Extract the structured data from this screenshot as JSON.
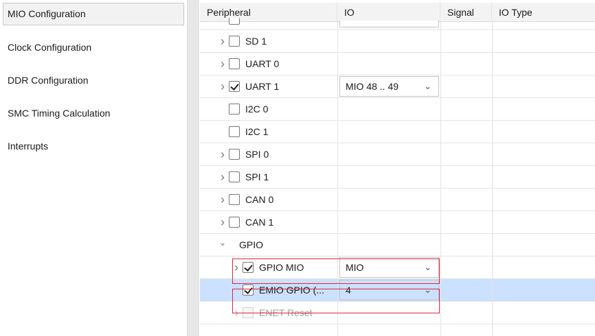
{
  "nav": {
    "items": [
      {
        "label": "MIO Configuration",
        "selected": true
      },
      {
        "label": "Clock Configuration",
        "selected": false
      },
      {
        "label": "DDR Configuration",
        "selected": false
      },
      {
        "label": "SMC Timing Calculation",
        "selected": false
      },
      {
        "label": "Interrupts",
        "selected": false
      }
    ]
  },
  "table": {
    "headers": {
      "peripheral": "Peripheral",
      "io": "IO",
      "signal": "Signal",
      "io_type": "IO Type"
    },
    "rows": [
      {
        "label": "SD 1",
        "expandable": true,
        "checked": false,
        "io": ""
      },
      {
        "label": "UART 0",
        "expandable": true,
        "checked": false,
        "io": ""
      },
      {
        "label": "UART 1",
        "expandable": true,
        "checked": true,
        "io": "MIO 48 .. 49"
      },
      {
        "label": "I2C 0",
        "expandable": false,
        "checked": false,
        "io": ""
      },
      {
        "label": "I2C 1",
        "expandable": false,
        "checked": false,
        "io": ""
      },
      {
        "label": "SPI 0",
        "expandable": true,
        "checked": false,
        "io": ""
      },
      {
        "label": "SPI 1",
        "expandable": true,
        "checked": false,
        "io": ""
      },
      {
        "label": "CAN 0",
        "expandable": true,
        "checked": false,
        "io": ""
      },
      {
        "label": "CAN 1",
        "expandable": true,
        "checked": false,
        "io": ""
      },
      {
        "label": "GPIO",
        "group": true,
        "expanded": true
      },
      {
        "label": "GPIO MIO",
        "expandable": true,
        "checked": true,
        "io": "MIO",
        "highlighted": true
      },
      {
        "label": "EMIO GPIO (...",
        "expandable": false,
        "checked": true,
        "io": "4",
        "selected": true,
        "highlighted": true
      },
      {
        "label": "ENET Reset",
        "expandable": true,
        "checked": false,
        "io": "",
        "disabled": true
      }
    ]
  },
  "colors": {
    "selection": "#cce0ff",
    "highlight_border": "#d9263a",
    "header_bg": "#f3f3f3"
  }
}
